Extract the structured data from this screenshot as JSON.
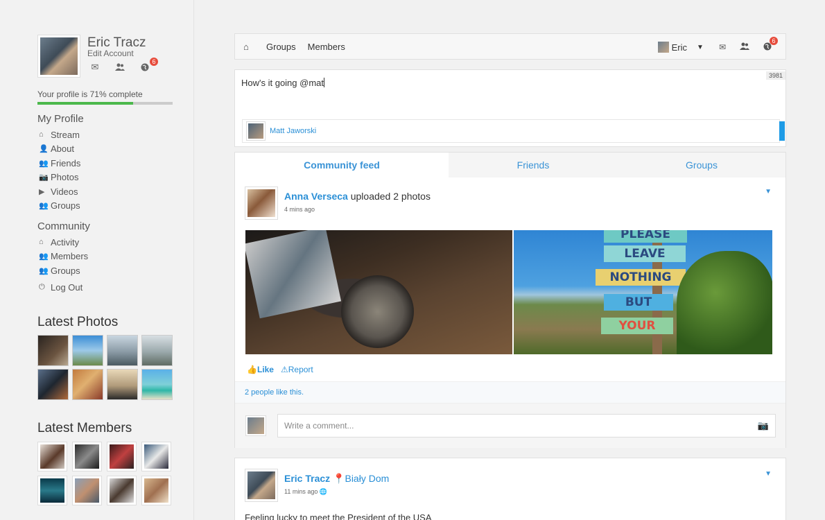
{
  "profile": {
    "name": "Eric Tracz",
    "edit_label": "Edit Account",
    "notifications_count": "6",
    "progress_text": "Your profile is 71% complete",
    "progress_percent": 71
  },
  "nav": {
    "my_profile_title": "My Profile",
    "my_profile_items": [
      {
        "label": "Stream",
        "icon": "home-icon"
      },
      {
        "label": "About",
        "icon": "user-icon"
      },
      {
        "label": "Friends",
        "icon": "friends-icon"
      },
      {
        "label": "Photos",
        "icon": "camera-icon"
      },
      {
        "label": "Videos",
        "icon": "play-icon"
      },
      {
        "label": "Groups",
        "icon": "groups-icon"
      }
    ],
    "community_title": "Community",
    "community_items": [
      {
        "label": "Activity",
        "icon": "home-icon"
      },
      {
        "label": "Members",
        "icon": "members-icon"
      },
      {
        "label": "Groups",
        "icon": "groups-icon"
      }
    ],
    "logout_label": "Log Out"
  },
  "latest_photos_title": "Latest Photos",
  "latest_members_title": "Latest Members",
  "topbar": {
    "groups_label": "Groups",
    "members_label": "Members",
    "user_label": "Eric",
    "notifications_count": "6"
  },
  "composer": {
    "text": "How's it going @mat",
    "char_count": "3981",
    "suggestion_name": "Matt Jaworski"
  },
  "tabs": [
    "Community feed",
    "Friends",
    "Groups"
  ],
  "post1": {
    "author": "Anna Verseca",
    "action": "uploaded 2 photos",
    "time": "4 mins ago",
    "sign_words": [
      "PLEASE",
      "LEAVE",
      "NOTHING",
      "BUT",
      "YOUR"
    ],
    "like_label": "Like",
    "report_label": "Report",
    "likes_text": "2 people like this.",
    "comment_placeholder": "Write a comment..."
  },
  "post2": {
    "author": "Eric Tracz",
    "location": "Biały Dom",
    "time": "11 mins ago",
    "text": "Feeling lucky to meet the President of the USA"
  },
  "colors": {
    "accent": "#2a8fd6",
    "progress": "#4cb84c",
    "badge": "#e74c3c"
  }
}
